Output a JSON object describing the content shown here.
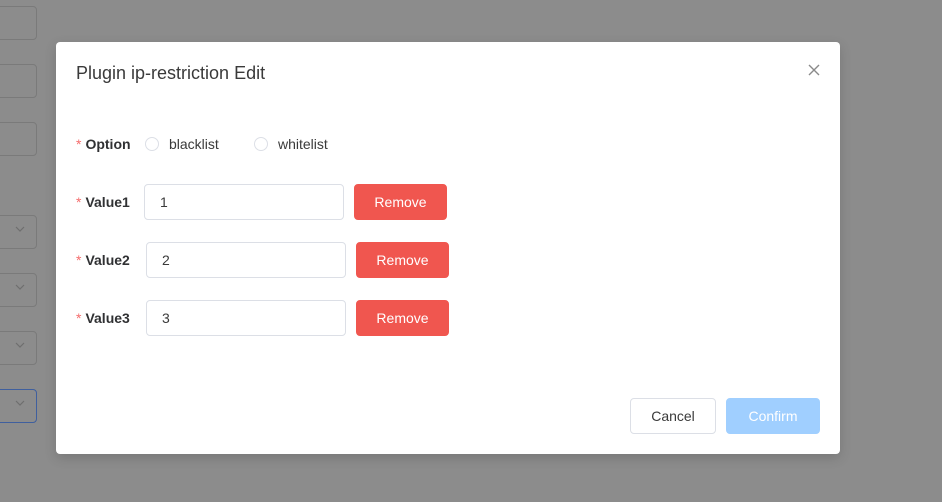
{
  "dialog": {
    "title": "Plugin ip-restriction Edit"
  },
  "form": {
    "option": {
      "required_mark": "*",
      "label": "Option",
      "choices": [
        {
          "label": "blacklist",
          "selected": false
        },
        {
          "label": "whitelist",
          "selected": false
        }
      ]
    },
    "values": [
      {
        "required_mark": "*",
        "label": "Value1",
        "value": "1",
        "remove_label": "Remove"
      },
      {
        "required_mark": "*",
        "label": "Value2",
        "value": "2",
        "remove_label": "Remove"
      },
      {
        "required_mark": "*",
        "label": "Value3",
        "value": "3",
        "remove_label": "Remove"
      }
    ]
  },
  "footer": {
    "cancel_label": "Cancel",
    "confirm_label": "Confirm"
  },
  "icons": {
    "close": "close-icon",
    "select_caret": "chevron-down-icon"
  },
  "colors": {
    "overlay": "#8c8c8c",
    "danger": "#f0564f",
    "required": "#f56c6c",
    "confirm_disabled": "#a0cfff",
    "focused_border": "#3f5f9e"
  }
}
